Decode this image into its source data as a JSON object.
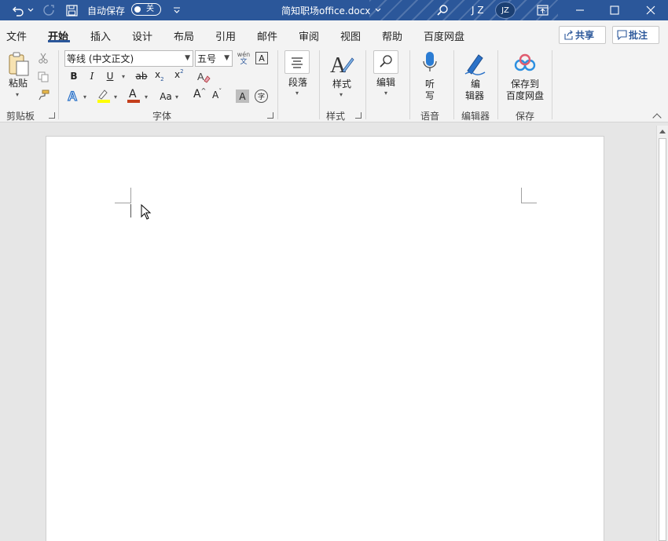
{
  "title_bar": {
    "autosave_label": "自动保存",
    "autosave_state": "关",
    "document_title": "简知职场office.docx",
    "user_initials": "J Z",
    "avatar_initials": "JZ"
  },
  "menu": {
    "tabs": [
      "文件",
      "开始",
      "插入",
      "设计",
      "布局",
      "引用",
      "邮件",
      "审阅",
      "视图",
      "帮助",
      "百度网盘"
    ],
    "active_tab": "开始",
    "share_label": "共享",
    "comments_label": "批注"
  },
  "ribbon": {
    "clipboard": {
      "paste_label": "粘贴",
      "group_label": "剪贴板"
    },
    "font": {
      "font_name": "等线 (中文正文)",
      "font_size": "五号",
      "phonetic_top": "wén",
      "phonetic_bottom": "文",
      "bold": "B",
      "italic": "I",
      "underline": "U",
      "strikethrough": "ab",
      "subscript": "x",
      "subscript_mark": "2",
      "superscript": "x",
      "superscript_mark": "2",
      "font_color_letter": "A",
      "change_case": "Aa",
      "grow_font": "A",
      "shrink_font": "A",
      "char_shading": "A",
      "enclose_char": "字",
      "group_label": "字体"
    },
    "paragraph": {
      "label": "段落"
    },
    "styles": {
      "label": "样式",
      "group_label": "样式"
    },
    "editing": {
      "label": "编辑"
    },
    "voice": {
      "label_line1": "听",
      "label_line2": "写",
      "group_label": "语音"
    },
    "editor": {
      "label_line1": "编",
      "label_line2": "辑器",
      "group_label": "编辑器"
    },
    "save": {
      "label_line1": "保存到",
      "label_line2": "百度网盘",
      "group_label": "保存"
    }
  },
  "colors": {
    "title_bar": "#2b579a",
    "ribbon_bg": "#f3f3f3",
    "highlight_yellow": "#ffff00",
    "font_color_red": "#c43e1c",
    "accent_blue": "#2b579a"
  }
}
